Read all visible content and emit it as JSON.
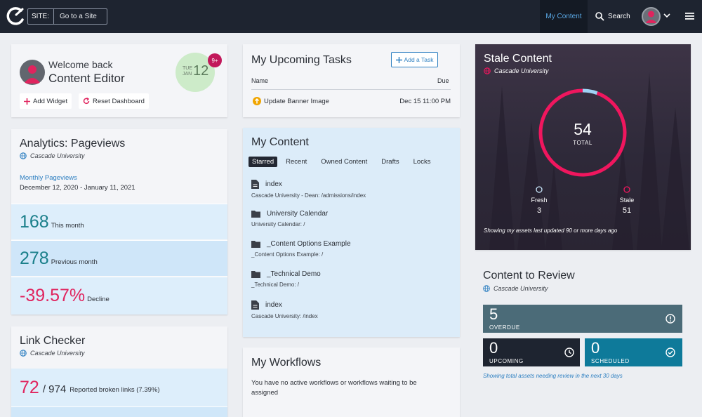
{
  "topbar": {
    "site_label": "SITE:",
    "site_placeholder": "Go to a Site",
    "my_content": "My Content",
    "search": "Search",
    "accent": "#5aa9e6"
  },
  "welcome": {
    "line1": "Welcome back",
    "line2": "Content Editor",
    "day": "TUE",
    "month": "JAN",
    "date": "12",
    "badge": "9+",
    "add_widget": "Add Widget",
    "reset_dashboard": "Reset Dashboard"
  },
  "analytics": {
    "title": "Analytics: Pageviews",
    "site": "Cascade University",
    "link": "Monthly Pageviews",
    "range": "December 12, 2020 - January 11, 2021",
    "stats": [
      {
        "value": "168",
        "label": "This month",
        "color": "#1a7f8a"
      },
      {
        "value": "278",
        "label": "Previous month",
        "color": "#1a7f8a"
      },
      {
        "value": "-39.57%",
        "label": "Decline",
        "color": "#e0245e"
      }
    ]
  },
  "link_checker": {
    "title": "Link Checker",
    "site": "Cascade University",
    "broken": "72",
    "total": "/ 974",
    "label": "Reported broken links (7.39%)"
  },
  "tasks": {
    "title": "My Upcoming Tasks",
    "add_task": "Add a Task",
    "col_name": "Name",
    "col_due": "Due",
    "rows": [
      {
        "name": "Update Banner Image",
        "due": "Dec 15 11:00 PM"
      }
    ]
  },
  "my_content": {
    "title": "My Content",
    "tabs": [
      "Starred",
      "Recent",
      "Owned Content",
      "Drafts",
      "Locks"
    ],
    "active_tab": "Starred",
    "items": [
      {
        "icon": "file-icon",
        "name": "index",
        "path": "Cascade University - Dean: /admissions/index"
      },
      {
        "icon": "folder-icon",
        "name": "University Calendar",
        "path": "University Calendar: /"
      },
      {
        "icon": "folder-icon",
        "name": "_Content Options Example",
        "path": "_Content Options Example: /"
      },
      {
        "icon": "folder-icon",
        "name": "_Technical Demo",
        "path": "_Technical Demo: /"
      },
      {
        "icon": "file-icon",
        "name": "index",
        "path": "Cascade University: /index"
      }
    ]
  },
  "workflows": {
    "title": "My Workflows",
    "text": "You have no active workflows or workflows waiting to be assigned"
  },
  "stale": {
    "title": "Stale Content",
    "site": "Cascade University",
    "total": "54",
    "total_label": "TOTAL",
    "fresh_label": "Fresh",
    "fresh": "3",
    "stale_label": "Stale",
    "stale_count": "51",
    "fresh_fraction": 0.0556,
    "footnote": "Showing my assets last updated 90 or more days ago",
    "colors": {
      "stale": "#f0165e",
      "fresh": "#9fd3f5"
    }
  },
  "review": {
    "title": "Content to Review",
    "site": "Cascade University",
    "overdue": "5",
    "overdue_label": "OVERDUE",
    "upcoming": "0",
    "upcoming_label": "UPCOMING",
    "scheduled": "0",
    "scheduled_label": "SCHEDULED",
    "footnote": "Showing total assets needing review in the next 30 days",
    "colors": {
      "overdue": "#4b6b78",
      "upcoming": "#1e2430",
      "scheduled": "#0e7a9a"
    }
  }
}
